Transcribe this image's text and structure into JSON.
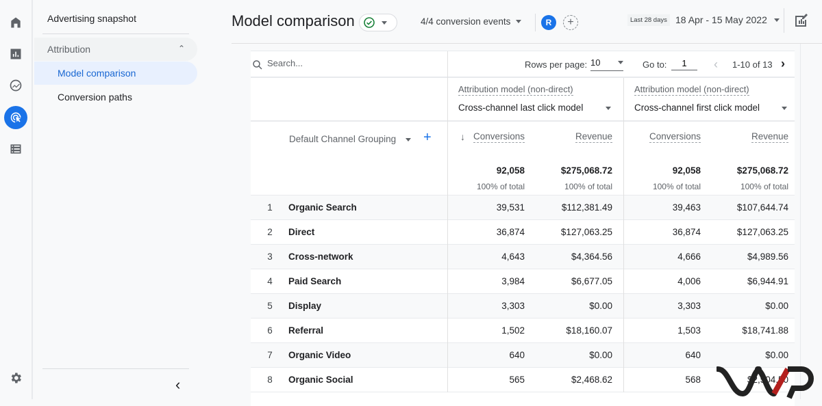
{
  "rail": {
    "icons": [
      "home-icon",
      "reports-icon",
      "explore-icon",
      "advertising-icon",
      "configure-icon",
      "settings-icon"
    ],
    "active": "advertising-icon",
    "accent_color": "#1a73e8"
  },
  "subnav": {
    "advertising_snapshot": "Advertising snapshot",
    "attribution": "Attribution",
    "model_comparison": "Model comparison",
    "conversion_paths": "Conversion paths",
    "collapse_label": "‹"
  },
  "header": {
    "title": "Model comparison",
    "conversion_events": "4/4 conversion events",
    "avatar_letter": "R",
    "add_comparison": "+",
    "date_badge": "Last 28 days",
    "date_range": "18 Apr - 15 May 2022"
  },
  "toolbar": {
    "search_placeholder": "Search...",
    "rows_per_page_label": "Rows per page:",
    "rows_per_page_value": "10",
    "goto_label": "Go to:",
    "goto_value": "1",
    "page_range": "1-10 of 13",
    "prev": "‹",
    "next": "›"
  },
  "table": {
    "models": [
      {
        "label": "Attribution model (non-direct)",
        "value": "Cross-channel last click model"
      },
      {
        "label": "Attribution model (non-direct)",
        "value": "Cross-channel first click model"
      }
    ],
    "dimension": "Default Channel Grouping",
    "add_dimension": "+",
    "sort_indicator": "↓",
    "metrics": [
      "Conversions",
      "Revenue",
      "Conversions",
      "Revenue"
    ],
    "totals": [
      "92,058",
      "$275,068.72",
      "92,058",
      "$275,068.72"
    ],
    "totals_pct": [
      "100% of total",
      "100% of total",
      "100% of total",
      "100% of total"
    ],
    "rows": [
      {
        "rank": "1",
        "channel": "Organic Search",
        "values": [
          "39,531",
          "$112,381.49",
          "39,463",
          "$107,644.74"
        ]
      },
      {
        "rank": "2",
        "channel": "Direct",
        "values": [
          "36,874",
          "$127,063.25",
          "36,874",
          "$127,063.25"
        ]
      },
      {
        "rank": "3",
        "channel": "Cross-network",
        "values": [
          "4,643",
          "$4,364.56",
          "4,666",
          "$4,989.56"
        ]
      },
      {
        "rank": "4",
        "channel": "Paid Search",
        "values": [
          "3,984",
          "$6,677.05",
          "4,006",
          "$6,944.91"
        ]
      },
      {
        "rank": "5",
        "channel": "Display",
        "values": [
          "3,303",
          "$0.00",
          "3,303",
          "$0.00"
        ]
      },
      {
        "rank": "6",
        "channel": "Referral",
        "values": [
          "1,502",
          "$18,160.07",
          "1,503",
          "$18,741.88"
        ]
      },
      {
        "rank": "7",
        "channel": "Organic Video",
        "values": [
          "640",
          "$0.00",
          "640",
          "$0.00"
        ]
      },
      {
        "rank": "8",
        "channel": "Organic Social",
        "values": [
          "565",
          "$2,468.62",
          "568",
          "$2,504.50"
        ]
      }
    ]
  }
}
